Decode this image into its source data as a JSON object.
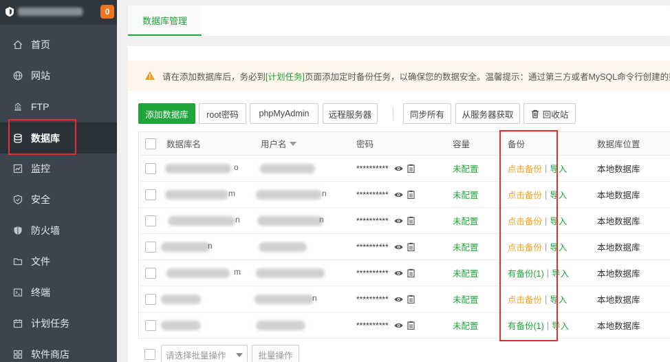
{
  "sidebar": {
    "badge": "0",
    "items": [
      {
        "label": "首页",
        "icon": "home-icon"
      },
      {
        "label": "网站",
        "icon": "globe-icon"
      },
      {
        "label": "FTP",
        "icon": "ftp-icon"
      },
      {
        "label": "数据库",
        "icon": "database-icon"
      },
      {
        "label": "监控",
        "icon": "monitor-icon"
      },
      {
        "label": "安全",
        "icon": "shield-icon"
      },
      {
        "label": "防火墙",
        "icon": "firewall-icon"
      },
      {
        "label": "文件",
        "icon": "folder-icon"
      },
      {
        "label": "终端",
        "icon": "terminal-icon"
      },
      {
        "label": "计划任务",
        "icon": "calendar-icon"
      },
      {
        "label": "软件商店",
        "icon": "store-icon"
      }
    ],
    "active_index": 3
  },
  "tabs": [
    "数据库管理"
  ],
  "notice": {
    "before": "请在添加数据库后，务必到",
    "link": "[计划任务]",
    "after": "页面添加定时备份任务，以确保您的数据安全。温馨提示：通过第三方或者MySQL命令行创建的数据库"
  },
  "toolbar": {
    "add": "添加数据库",
    "root_pwd": "root密码",
    "phpmyadmin": "phpMyAdmin",
    "remote": "远程服务器",
    "sync_all": "同步所有",
    "fetch": "从服务器获取",
    "recycle": "回收站"
  },
  "table": {
    "headers": {
      "name": "数据库名",
      "user": "用户名",
      "password": "密码",
      "capacity": "容量",
      "backup": "备份",
      "location": "数据库位置"
    },
    "rows": [
      {
        "name_tail": "o",
        "user_tail": "",
        "password": "**********",
        "capacity": "未配置",
        "backup": "点击备份",
        "backup_state": "none",
        "import": "导入",
        "location": "本地数据库"
      },
      {
        "name_tail": "m",
        "user_tail": "n",
        "password": "**********",
        "capacity": "未配置",
        "backup": "点击备份",
        "backup_state": "none",
        "import": "导入",
        "location": "本地数据库"
      },
      {
        "name_tail": "n",
        "user_tail": "n",
        "password": "**********",
        "capacity": "未配置",
        "backup": "点击备份",
        "backup_state": "none",
        "import": "导入",
        "location": "本地数据库"
      },
      {
        "name_tail": "n",
        "user_tail": "",
        "password": "**********",
        "capacity": "未配置",
        "backup": "点击备份",
        "backup_state": "none",
        "import": "导入",
        "location": "本地数据库"
      },
      {
        "name_tail": "m",
        "user_tail": "",
        "password": "**********",
        "capacity": "未配置",
        "backup": "有备份(1)",
        "backup_state": "has",
        "import": "导入",
        "location": "本地数据库"
      },
      {
        "name_tail": "",
        "user_tail": "n",
        "password": "**********",
        "capacity": "未配置",
        "backup": "点击备份",
        "backup_state": "none",
        "import": "导入",
        "location": "本地数据库"
      },
      {
        "name_tail": "",
        "user_tail": "",
        "password": "**********",
        "capacity": "未配置",
        "backup": "有备份(1)",
        "backup_state": "has",
        "import": "导入",
        "location": "本地数据库"
      }
    ]
  },
  "bottom": {
    "batch_placeholder": "请选择批量操作",
    "batch_button": "批量操作"
  },
  "colors": {
    "brand_green": "#20a53a",
    "warning_orange": "#f0a020",
    "highlight_red": "#e03030"
  }
}
